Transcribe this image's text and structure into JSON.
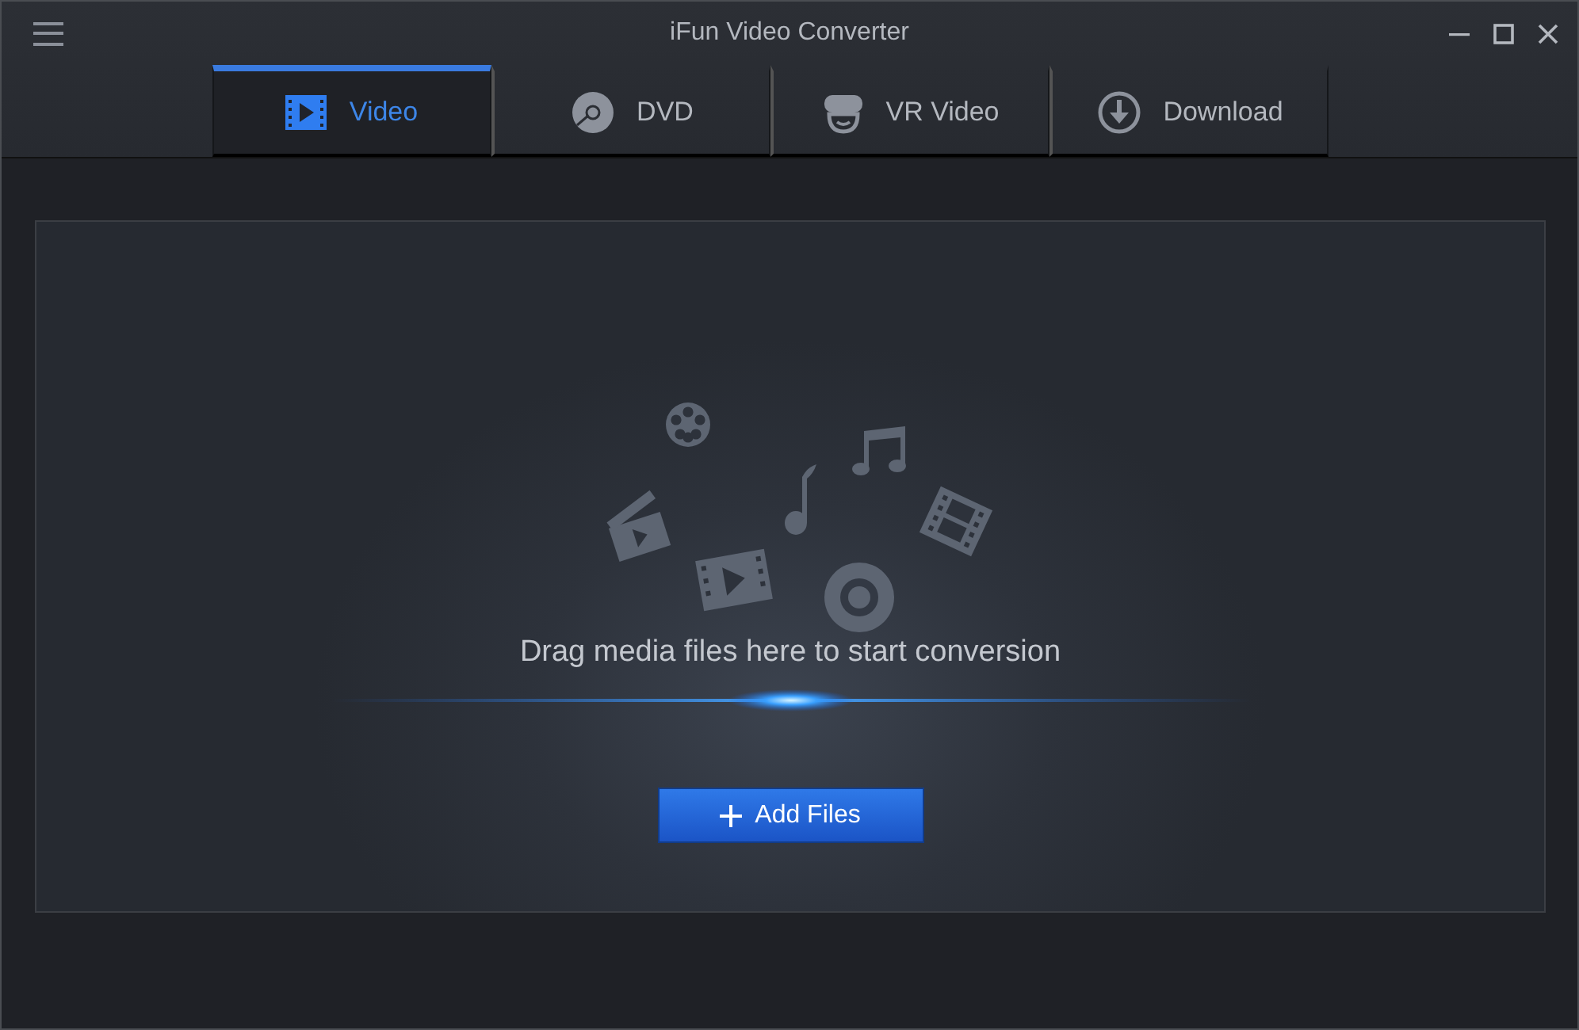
{
  "window": {
    "title": "iFun Video Converter"
  },
  "tabs": [
    {
      "label": "Video",
      "kind": "video",
      "selected": true
    },
    {
      "label": "DVD",
      "kind": "dvd",
      "selected": false
    },
    {
      "label": "VR Video",
      "kind": "vr",
      "selected": false
    },
    {
      "label": "Download",
      "kind": "download",
      "selected": false
    }
  ],
  "dropzone": {
    "message": "Drag media files here to start conversion",
    "button": "Add Files"
  }
}
